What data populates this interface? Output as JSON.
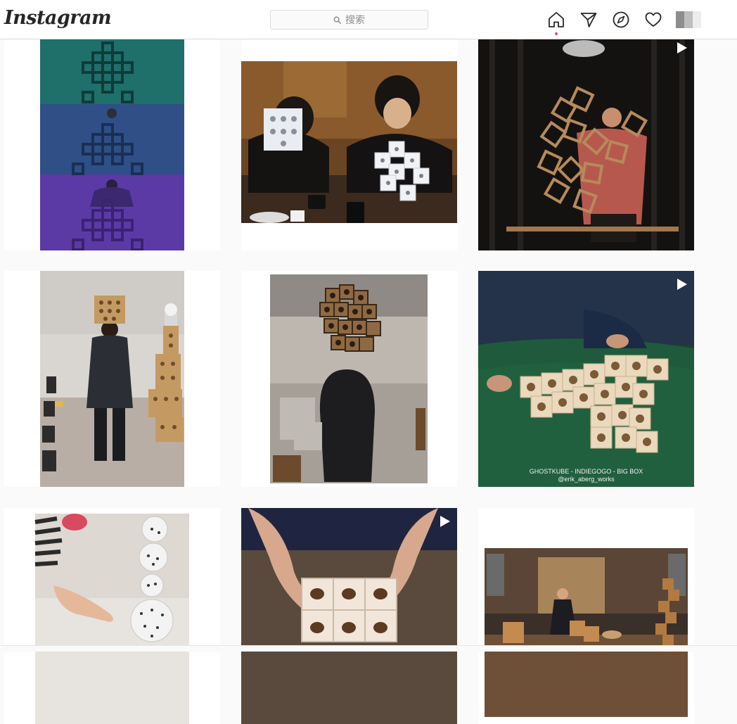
{
  "brand": {
    "logo_text": "Instagram"
  },
  "search": {
    "placeholder": "搜索"
  },
  "nav": {
    "icons": [
      "home-icon",
      "direct-message-icon",
      "explore-icon",
      "activity-heart-icon",
      "profile-avatar"
    ],
    "active": "home",
    "notification_dot_color": "#ed4956"
  },
  "grid": {
    "posts": [
      {
        "id": "post-1",
        "media": "image",
        "subject": "three-panel photo of person behind stacked cube sculpture in teal, blue and purple light"
      },
      {
        "id": "post-2",
        "media": "image",
        "subject": "people at a cafe table assembling white hollow cubes"
      },
      {
        "id": "post-3",
        "media": "video",
        "subject": "man on dark stage holding a lattice of hollow wooden frames"
      },
      {
        "id": "post-4",
        "media": "image",
        "subject": "man walking in gallery with cube sculpture balanced on head"
      },
      {
        "id": "post-5",
        "media": "image",
        "subject": "person wearing a wooden cube structure over the head"
      },
      {
        "id": "post-6",
        "media": "video",
        "subject": "hands arranging wooden cubes on green table",
        "caption_line1": "GHOSTKUBE - INDIEGOGO - BIG BOX",
        "caption_line2": "@erik_aberg_works"
      },
      {
        "id": "post-7",
        "media": "image",
        "subject": "child's hand next to stacked white polyhedral dice"
      },
      {
        "id": "post-8",
        "media": "video",
        "subject": "hands pressing into wooden cubes"
      },
      {
        "id": "post-9",
        "media": "image",
        "subject": "performer on a stage with wooden cube structures"
      }
    ]
  },
  "colors": {
    "accent_dot": "#ed4956",
    "border": "#dbdbdb",
    "text": "#262626",
    "muted": "#8e8e8e"
  }
}
